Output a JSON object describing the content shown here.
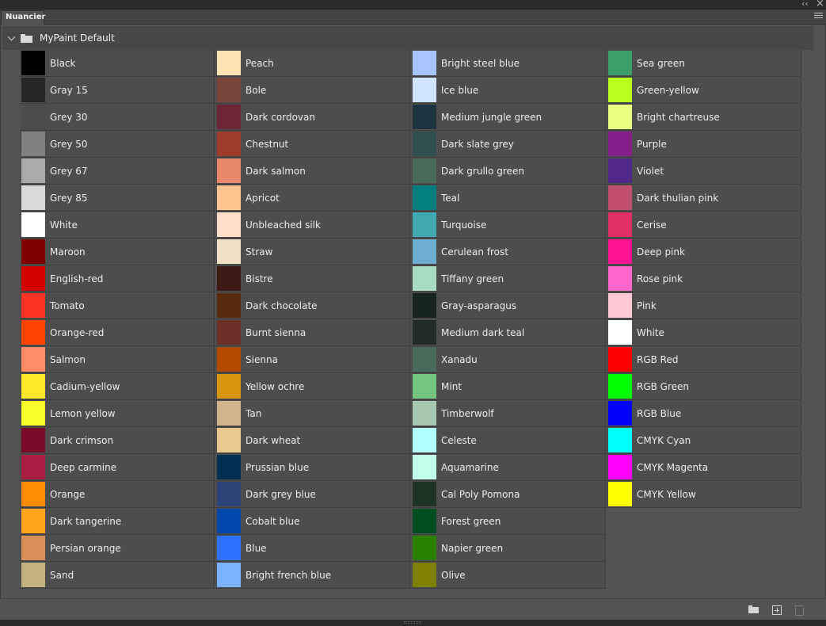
{
  "window": {
    "collapse_glyph": "‹‹",
    "close_glyph": "×"
  },
  "tab": {
    "label": "Nuancier"
  },
  "group": {
    "title": "MyPaint Default"
  },
  "icons": {
    "panel_menu": "hamburger-menu-icon",
    "group_toggle": "chevron-down-icon",
    "group_folder": "folder-icon",
    "new_group": "folder-icon",
    "new_swatch": "add-swatch-icon",
    "delete": "trash-icon"
  },
  "swatch_columns": [
    [
      {
        "name": "Black",
        "color": "#000000"
      },
      {
        "name": "Gray 15",
        "color": "#262626"
      },
      {
        "name": "Grey 30",
        "color": "#4c4c4c"
      },
      {
        "name": "Grey 50",
        "color": "#808080"
      },
      {
        "name": "Grey 67",
        "color": "#aaaaaa"
      },
      {
        "name": "Grey 85",
        "color": "#d9d9d9"
      },
      {
        "name": "White",
        "color": "#ffffff"
      },
      {
        "name": "Maroon",
        "color": "#800000"
      },
      {
        "name": "English-red",
        "color": "#d40000"
      },
      {
        "name": "Tomato",
        "color": "#ff3324"
      },
      {
        "name": "Orange-red",
        "color": "#ff4500"
      },
      {
        "name": "Salmon",
        "color": "#ff8c69"
      },
      {
        "name": "Cadium-yellow",
        "color": "#fde92a"
      },
      {
        "name": "Lemon yellow",
        "color": "#f6ff2c"
      },
      {
        "name": "Dark crimson",
        "color": "#7a0a2a"
      },
      {
        "name": "Deep carmine",
        "color": "#a81d40"
      },
      {
        "name": "Orange",
        "color": "#ff8c00"
      },
      {
        "name": "Dark tangerine",
        "color": "#ffa51b"
      },
      {
        "name": "Persian orange",
        "color": "#d99058"
      },
      {
        "name": "Sand",
        "color": "#c2b280"
      }
    ],
    [
      {
        "name": "Peach",
        "color": "#ffe5b4"
      },
      {
        "name": "Bole",
        "color": "#79443b"
      },
      {
        "name": "Dark cordovan",
        "color": "#6e2637"
      },
      {
        "name": "Chestnut",
        "color": "#9e3b2a"
      },
      {
        "name": "Dark salmon",
        "color": "#e9886a"
      },
      {
        "name": "Apricot",
        "color": "#ffc490"
      },
      {
        "name": "Unbleached silk",
        "color": "#ffddca"
      },
      {
        "name": "Straw",
        "color": "#f0e0c8"
      },
      {
        "name": "Bistre",
        "color": "#3d1a14"
      },
      {
        "name": "Dark chocolate",
        "color": "#5a2a10"
      },
      {
        "name": "Burnt sienna",
        "color": "#6d3028"
      },
      {
        "name": "Sienna",
        "color": "#b24a00"
      },
      {
        "name": "Yellow ochre",
        "color": "#d8970e"
      },
      {
        "name": "Tan",
        "color": "#d2b48c"
      },
      {
        "name": "Dark wheat",
        "color": "#e8c88c"
      },
      {
        "name": "Prussian blue",
        "color": "#003153"
      },
      {
        "name": "Dark grey blue",
        "color": "#2e4478"
      },
      {
        "name": "Cobalt blue",
        "color": "#0047ab"
      },
      {
        "name": "Blue",
        "color": "#2a72ff"
      },
      {
        "name": "Bright french blue",
        "color": "#7ab2ff"
      }
    ],
    [
      {
        "name": "Bright steel blue",
        "color": "#a8c4ff"
      },
      {
        "name": "Ice blue",
        "color": "#d0e4ff"
      },
      {
        "name": "Medium jungle green",
        "color": "#1c3540"
      },
      {
        "name": "Dark slate grey",
        "color": "#2f4f4f"
      },
      {
        "name": "Dark grullo green",
        "color": "#4a6a5a"
      },
      {
        "name": "Teal",
        "color": "#008080"
      },
      {
        "name": "Turquoise",
        "color": "#40a8b0"
      },
      {
        "name": "Cerulean frost",
        "color": "#6daed0"
      },
      {
        "name": "Tiffany green",
        "color": "#a8dcc0"
      },
      {
        "name": "Gray-asparagus",
        "color": "#162420"
      },
      {
        "name": "Medium dark teal",
        "color": "#212d2a"
      },
      {
        "name": "Xanadu",
        "color": "#4a6a5c"
      },
      {
        "name": "Mint",
        "color": "#74c680"
      },
      {
        "name": "Timberwolf",
        "color": "#a8c8b0"
      },
      {
        "name": "Celeste",
        "color": "#b2ffff"
      },
      {
        "name": "Aquamarine",
        "color": "#c0ffe8"
      },
      {
        "name": "Cal Poly Pomona",
        "color": "#1d3324"
      },
      {
        "name": "Forest green",
        "color": "#004d20"
      },
      {
        "name": "Napier green",
        "color": "#2a8000"
      },
      {
        "name": "Olive",
        "color": "#808000"
      }
    ],
    [
      {
        "name": "Sea green",
        "color": "#3e9e6a"
      },
      {
        "name": "Green-yellow",
        "color": "#b8ff1e"
      },
      {
        "name": "Bright chartreuse",
        "color": "#e8ff80"
      },
      {
        "name": "Purple",
        "color": "#841e88"
      },
      {
        "name": "Violet",
        "color": "#502888"
      },
      {
        "name": "Dark thulian pink",
        "color": "#c0506e"
      },
      {
        "name": "Cerise",
        "color": "#e02e66"
      },
      {
        "name": "Deep pink",
        "color": "#ff1493"
      },
      {
        "name": "Rose pink",
        "color": "#ff66cc"
      },
      {
        "name": "Pink",
        "color": "#ffc8d6"
      },
      {
        "name": "White",
        "color": "#ffffff"
      },
      {
        "name": "RGB Red",
        "color": "#ff0000"
      },
      {
        "name": "RGB Green",
        "color": "#00ff00"
      },
      {
        "name": "RGB Blue",
        "color": "#0000ff"
      },
      {
        "name": "CMYK Cyan",
        "color": "#00ffff"
      },
      {
        "name": "CMYK Magenta",
        "color": "#ff00ff"
      },
      {
        "name": "CMYK Yellow",
        "color": "#ffff00"
      }
    ]
  ]
}
